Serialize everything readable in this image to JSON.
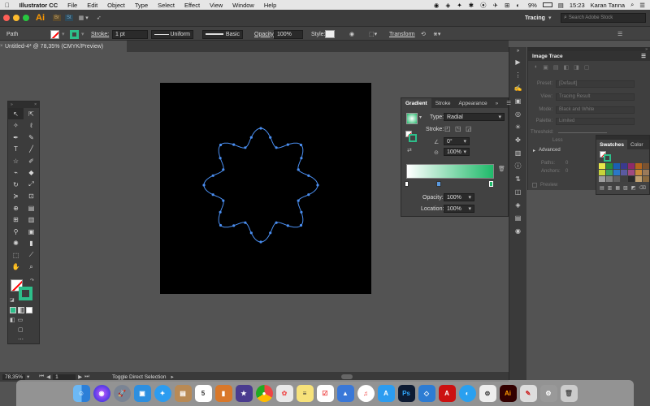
{
  "menubar": {
    "apple": "",
    "app_name": "Illustrator CC",
    "items": [
      "File",
      "Edit",
      "Object",
      "Type",
      "Select",
      "Effect",
      "View",
      "Window",
      "Help"
    ],
    "battery": "9%",
    "time": "15:23",
    "user": "Karan Tanna"
  },
  "appbar": {
    "logo": "Ai",
    "br_label": "Br",
    "st_label": "St",
    "workspace": "Tracing",
    "search_placeholder": "Search Adobe Stock"
  },
  "controlbar": {
    "selection_label": "Path",
    "stroke_label": "Stroke:",
    "stroke_value": "1 pt",
    "uniform_label": "Uniform",
    "basic_label": "Basic",
    "opacity_label": "Opacity:",
    "opacity_value": "100%",
    "style_label": "Style:",
    "transform_label": "Transform"
  },
  "document": {
    "tab_title": "Untitled-4* @ 78,35% (CMYK/Preview)"
  },
  "statusbar": {
    "zoom": "78,35%",
    "artboard": "1",
    "status_text": "Toggle Direct Selection"
  },
  "image_trace": {
    "title": "Image Trace",
    "preset_label": "Preset:",
    "preset_value": "[Default]",
    "view_label": "View:",
    "view_value": "Tracing Result",
    "mode_label": "Mode:",
    "mode_value": "Black and White",
    "palette_label": "Palette:",
    "palette_value": "Limited",
    "threshold_label": "Threshold:",
    "less_label": "Less",
    "advanced_label": "Advanced",
    "paths_label": "Paths:",
    "paths_value": "0",
    "anchors_label": "Anchors:",
    "anchors_value": "0",
    "preview_label": "Preview"
  },
  "gradient_panel": {
    "tabs": [
      "Gradient",
      "Stroke",
      "Appearance"
    ],
    "type_label": "Type:",
    "type_value": "Radial",
    "stroke_label": "Stroke:",
    "angle_value": "0°",
    "aspect_value": "100%",
    "opacity_label": "Opacity:",
    "opacity_value": "100%",
    "location_label": "Location:",
    "location_value": "100%",
    "colors": {
      "start": "#ffffff",
      "end": "#1fba6a"
    }
  },
  "swatches_panel": {
    "tabs": [
      "Swatches",
      "Color"
    ]
  },
  "tools": [
    "selection-tool",
    "direct-selection-tool",
    "magic-wand-tool",
    "lasso-tool",
    "pen-tool",
    "pencil-tool",
    "type-tool",
    "line-tool",
    "star-tool",
    "paintbrush-tool",
    "shaper-tool",
    "eraser-tool",
    "rotate-tool",
    "scale-tool",
    "width-tool",
    "free-transform-tool",
    "shape-builder-tool",
    "perspective-tool",
    "mesh-tool",
    "gradient-tool",
    "eyedropper-tool",
    "blend-tool",
    "symbol-sprayer-tool",
    "column-graph-tool",
    "artboard-tool",
    "slice-tool",
    "hand-tool",
    "zoom-tool"
  ],
  "dock": {
    "calendar_day": "5",
    "items": [
      "finder",
      "siri",
      "launchpad",
      "preview",
      "safari",
      "contacts",
      "calendar",
      "books",
      "imovie",
      "chrome",
      "photos",
      "notes",
      "reminders",
      "keynote",
      "itunes",
      "appstore",
      "photoshop",
      "vscode",
      "acrobat",
      "messages",
      "sourcetree",
      "illustrator",
      "notepad",
      "misc",
      "trash"
    ]
  }
}
